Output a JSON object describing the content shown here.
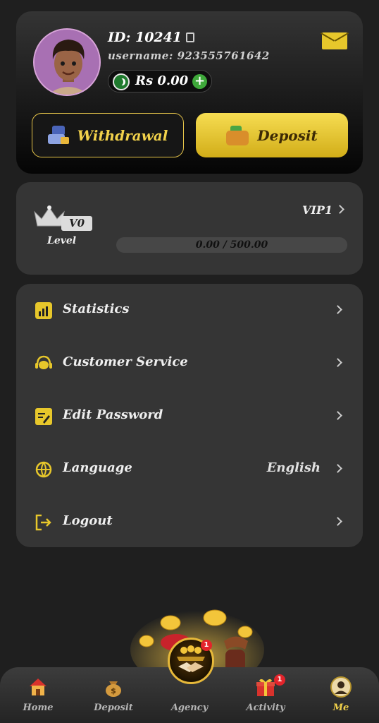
{
  "profile": {
    "id_text": "ID: 10241",
    "username_text": "username: 923555761642",
    "balance": "Rs 0.00"
  },
  "buttons": {
    "withdrawal": "Withdrawal",
    "deposit": "Deposit"
  },
  "vip": {
    "current_level": "V0",
    "level_label": "Level",
    "next_level": "VIP1",
    "progress_text": "0.00 / 500.00",
    "progress_fraction": 0
  },
  "menu": {
    "items": [
      {
        "label": "Statistics",
        "value": "",
        "icon": "statistics-icon"
      },
      {
        "label": "Customer Service",
        "value": "",
        "icon": "headset-icon"
      },
      {
        "label": "Edit Password",
        "value": "",
        "icon": "edit-icon"
      },
      {
        "label": "Language",
        "value": "English",
        "icon": "globe-icon"
      },
      {
        "label": "Logout",
        "value": "",
        "icon": "logout-icon"
      }
    ]
  },
  "tabs": [
    {
      "label": "Home",
      "icon": "home-icon"
    },
    {
      "label": "Deposit",
      "icon": "money-bag-icon"
    },
    {
      "label": "Agency",
      "icon": "handshake-icon",
      "badge": "1"
    },
    {
      "label": "Activity",
      "icon": "gift-icon",
      "badge": "1"
    },
    {
      "label": "Me",
      "icon": "profile-icon",
      "active": true
    }
  ],
  "colors": {
    "accent": "#e7c72b",
    "background": "#1f1f1f",
    "card": "#353535",
    "badge": "#e3242b"
  }
}
